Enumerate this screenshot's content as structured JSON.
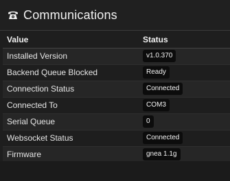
{
  "panel": {
    "title": "Communications",
    "icon": "telephone-icon"
  },
  "table": {
    "headers": {
      "value": "Value",
      "status": "Status"
    },
    "rows": [
      {
        "label": "Installed Version",
        "status": "v1.0.370"
      },
      {
        "label": "Backend Queue Blocked",
        "status": "Ready"
      },
      {
        "label": "Connection Status",
        "status": "Connected"
      },
      {
        "label": "Connected To",
        "status": "COM3"
      },
      {
        "label": "Serial Queue",
        "status": "0"
      },
      {
        "label": "Websocket Status",
        "status": "Connected"
      },
      {
        "label": "Firmware",
        "status": "gnea 1.1g"
      }
    ]
  },
  "colors": {
    "background": "#1e1e1e",
    "badge": "#0c0c0c",
    "text": "#e6e6e6"
  }
}
